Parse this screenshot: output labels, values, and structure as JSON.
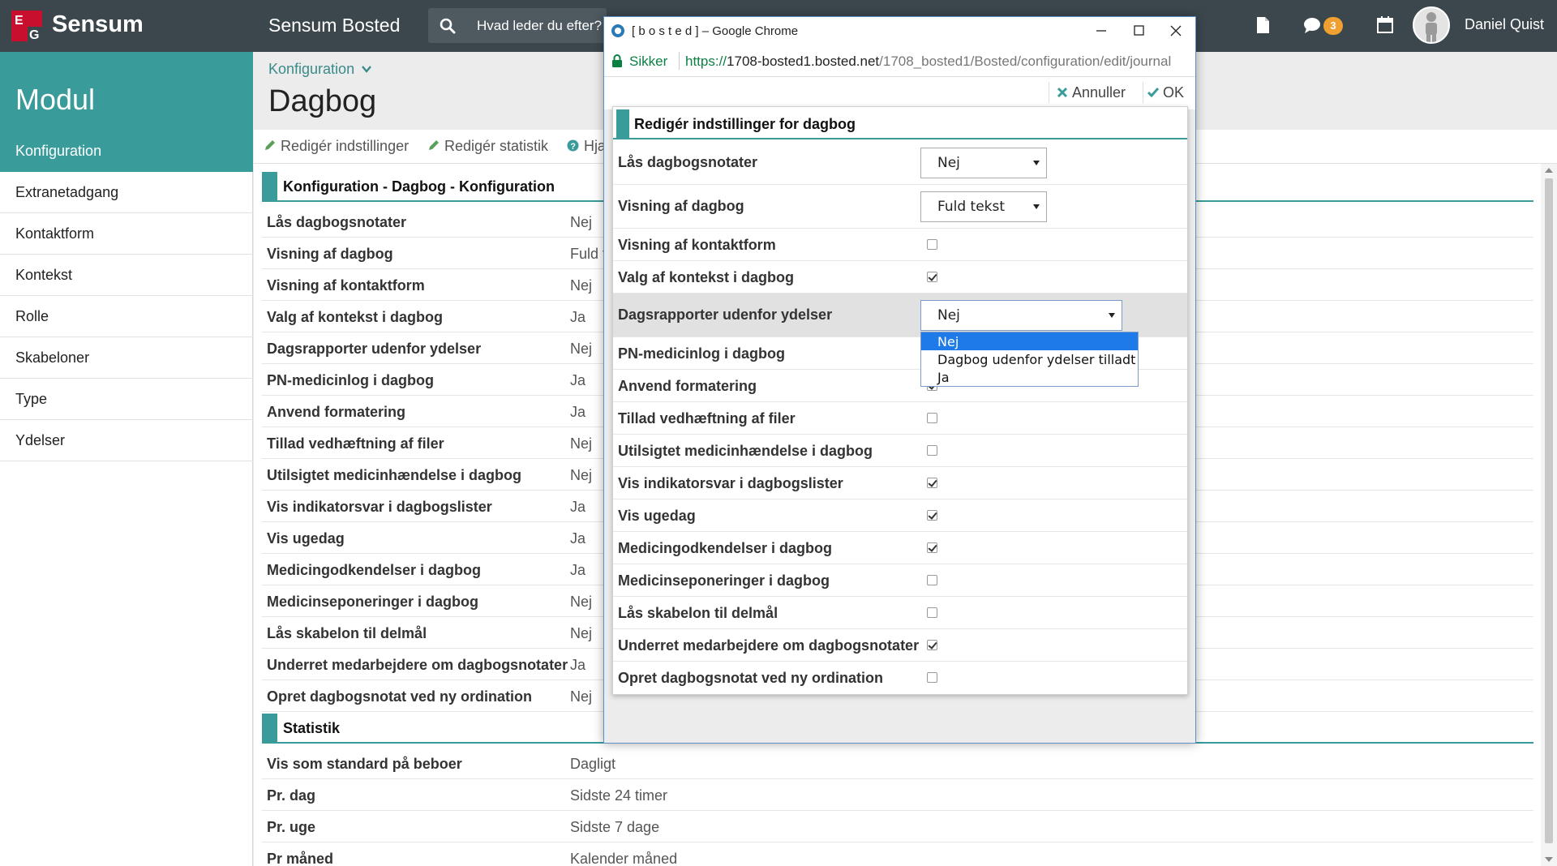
{
  "topbar": {
    "brand": "Sensum",
    "app_title": "Sensum Bosted",
    "search_placeholder": "Hvad leder du efter?",
    "chat_badge": "3",
    "user_name": "Daniel Quist"
  },
  "sidebar": {
    "header": "Modul",
    "items": [
      {
        "label": "Konfiguration"
      },
      {
        "label": "Extranetadgang"
      },
      {
        "label": "Kontaktform"
      },
      {
        "label": "Kontekst"
      },
      {
        "label": "Rolle"
      },
      {
        "label": "Skabeloner"
      },
      {
        "label": "Type"
      },
      {
        "label": "Ydelser"
      }
    ]
  },
  "main": {
    "breadcrumb": "Konfiguration",
    "title": "Dagbog",
    "toolbar": {
      "edit_settings": "Redigér indstillinger",
      "edit_stats": "Redigér statistik",
      "help": "Hjælp"
    },
    "config_section": "Konfiguration - Dagbog - Konfiguration",
    "config_rows": [
      {
        "key": "Lås dagbogsnotater",
        "value": "Nej"
      },
      {
        "key": "Visning af dagbog",
        "value": "Fuld tekst"
      },
      {
        "key": "Visning af kontaktform",
        "value": "Nej"
      },
      {
        "key": "Valg af kontekst i dagbog",
        "value": "Ja"
      },
      {
        "key": "Dagsrapporter udenfor ydelser",
        "value": "Nej"
      },
      {
        "key": "PN-medicinlog i dagbog",
        "value": "Ja"
      },
      {
        "key": "Anvend formatering",
        "value": "Ja"
      },
      {
        "key": "Tillad vedhæftning af filer",
        "value": "Nej"
      },
      {
        "key": "Utilsigtet medicinhændelse i dagbog",
        "value": "Nej"
      },
      {
        "key": "Vis indikatorsvar i dagbogslister",
        "value": "Ja"
      },
      {
        "key": "Vis ugedag",
        "value": "Ja"
      },
      {
        "key": "Medicingodkendelser i dagbog",
        "value": "Ja"
      },
      {
        "key": "Medicinseponeringer i dagbog",
        "value": "Nej"
      },
      {
        "key": "Lås skabelon til delmål",
        "value": "Nej"
      },
      {
        "key": "Underret medarbejdere om dagbogsnotater",
        "value": "Ja"
      },
      {
        "key": "Opret dagbogsnotat ved ny ordination",
        "value": "Nej"
      }
    ],
    "stats_section": "Statistik",
    "stats_rows": [
      {
        "key": "Vis som standard på beboer",
        "value": "Dagligt"
      },
      {
        "key": "Pr. dag",
        "value": "Sidste 24 timer"
      },
      {
        "key": "Pr. uge",
        "value": "Sidste 7 dage"
      },
      {
        "key": "Pr måned",
        "value": "Kalender måned"
      }
    ]
  },
  "popup": {
    "window_title": "[ b o s t e d ] – Google Chrome",
    "secure_label": "Sikker",
    "url_scheme": "https://",
    "url_host": "1708-bosted1.bosted.net",
    "url_path": "/1708_bosted1/Bosted/configuration/edit/journal",
    "cancel_label": "Annuller",
    "ok_label": "OK",
    "dialog_title": "Redigér indstillinger for dagbog",
    "fields": [
      {
        "label": "Lås dagbogsnotater",
        "type": "select",
        "value": "Nej"
      },
      {
        "label": "Visning af dagbog",
        "type": "select",
        "value": "Fuld tekst"
      },
      {
        "label": "Visning af kontaktform",
        "type": "checkbox",
        "checked": false
      },
      {
        "label": "Valg af kontekst i dagbog",
        "type": "checkbox",
        "checked": true
      },
      {
        "label": "Dagsrapporter udenfor ydelser",
        "type": "select",
        "value": "Nej"
      },
      {
        "label": "PN-medicinlog i dagbog",
        "type": "checkbox",
        "checked": true
      },
      {
        "label": "Anvend formatering",
        "type": "checkbox",
        "checked": true
      },
      {
        "label": "Tillad vedhæftning af filer",
        "type": "checkbox",
        "checked": false
      },
      {
        "label": "Utilsigtet medicinhændelse i dagbog",
        "type": "checkbox",
        "checked": false
      },
      {
        "label": "Vis indikatorsvar i dagbogslister",
        "type": "checkbox",
        "checked": true
      },
      {
        "label": "Vis ugedag",
        "type": "checkbox",
        "checked": true
      },
      {
        "label": "Medicingodkendelser i dagbog",
        "type": "checkbox",
        "checked": true
      },
      {
        "label": "Medicinseponeringer i dagbog",
        "type": "checkbox",
        "checked": false
      },
      {
        "label": "Lås skabelon til delmål",
        "type": "checkbox",
        "checked": false
      },
      {
        "label": "Underret medarbejdere om dagbogsnotater",
        "type": "checkbox",
        "checked": true
      },
      {
        "label": "Opret dagbogsnotat ved ny ordination",
        "type": "checkbox",
        "checked": false
      }
    ],
    "dropdown_options": [
      "Nej",
      "Dagbog udenfor ydelser tilladt",
      "Ja"
    ],
    "dropdown_selected": "Nej"
  },
  "colors": {
    "accent": "#3a9b9b",
    "topbar": "#3c474d",
    "badge": "#f0a030",
    "dropdown_highlight": "#1e7ae8"
  }
}
